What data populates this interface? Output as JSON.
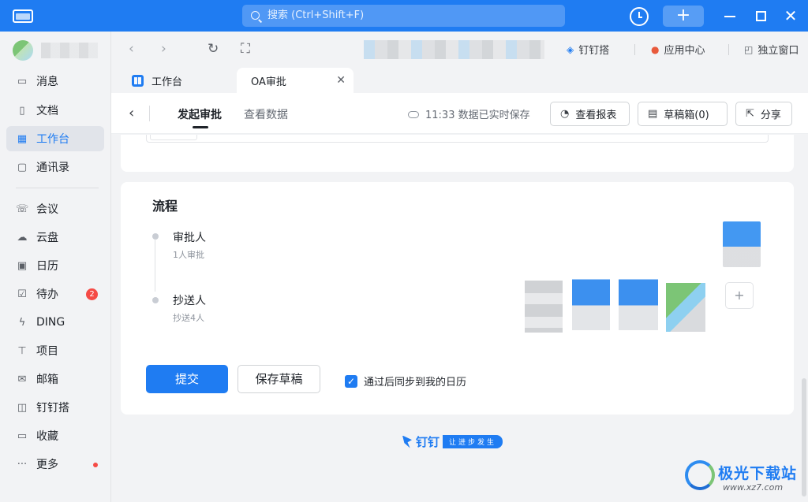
{
  "titlebar": {
    "search_placeholder": "搜索 (Ctrl+Shift+F)"
  },
  "sidebar": {
    "items": [
      {
        "label": "消息",
        "icon": "message-icon"
      },
      {
        "label": "文档",
        "icon": "document-icon"
      },
      {
        "label": "工作台",
        "icon": "workbench-icon",
        "active": true
      },
      {
        "label": "通讯录",
        "icon": "contacts-icon"
      },
      {
        "label": "会议",
        "icon": "meeting-icon"
      },
      {
        "label": "云盘",
        "icon": "cloud-drive-icon"
      },
      {
        "label": "日历",
        "icon": "calendar-icon"
      },
      {
        "label": "待办",
        "icon": "todo-icon",
        "badge": "2"
      },
      {
        "label": "DING",
        "icon": "ding-icon"
      },
      {
        "label": "项目",
        "icon": "project-icon"
      },
      {
        "label": "邮箱",
        "icon": "mail-icon"
      },
      {
        "label": "钉钉搭",
        "icon": "dingda-icon"
      },
      {
        "label": "收藏",
        "icon": "favorites-icon"
      },
      {
        "label": "更多",
        "icon": "more-icon",
        "dot": true
      }
    ]
  },
  "toolbar": {
    "dingda": "钉钉搭",
    "app_center": "应用中心",
    "standalone": "独立窗口"
  },
  "tabs": [
    {
      "label": "工作台"
    },
    {
      "label": "OA审批",
      "active": true
    }
  ],
  "page": {
    "tab_initiate": "发起审批",
    "tab_data": "查看数据",
    "saved_status": "11:33 数据已实时保存",
    "btn_report": "查看报表",
    "btn_drafts": "草稿箱(0)",
    "btn_share": "分享"
  },
  "flow": {
    "title": "流程",
    "approver_label": "审批人",
    "approver_sub": "1人审批",
    "cc_label": "抄送人",
    "cc_sub": "抄送4人"
  },
  "actions": {
    "submit": "提交",
    "save_draft": "保存草稿",
    "sync_calendar": "通过后同步到我的日历",
    "sync_checked": true
  },
  "footer": {
    "brand_name": "钉钉",
    "brand_tagline": "让进步发生"
  },
  "watermark": {
    "title": "极光下载站",
    "url": "www.xz7.com"
  },
  "colors": {
    "accent": "#1f7cf2",
    "badge": "#f54a45",
    "background": "#f2f3f5"
  }
}
